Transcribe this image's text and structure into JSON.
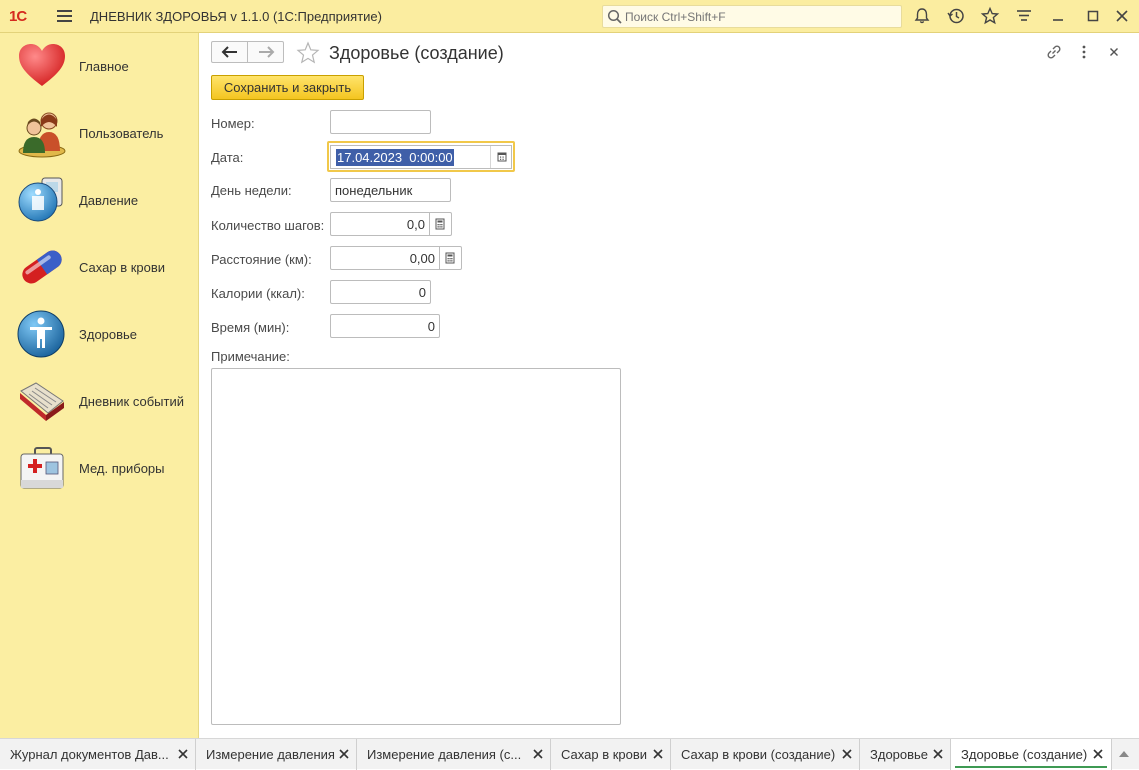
{
  "app": {
    "logo": "1С",
    "title": "ДНЕВНИК ЗДОРОВЬЯ v 1.1.0  (1С:Предприятие)",
    "search_placeholder": "Поиск Ctrl+Shift+F"
  },
  "toolbar_icons": [
    "bell-icon",
    "history-icon",
    "star-icon",
    "settings-icon",
    "minimize-icon",
    "maximize-icon",
    "close-icon"
  ],
  "sidebar": {
    "items": [
      {
        "label": "Главное",
        "icon": "heart-icon"
      },
      {
        "label": "Пользователь",
        "icon": "users-icon"
      },
      {
        "label": "Давление",
        "icon": "pressure-icon"
      },
      {
        "label": "Сахар в крови",
        "icon": "pill-icon"
      },
      {
        "label": "Здоровье",
        "icon": "person-icon"
      },
      {
        "label": "Дневник событий",
        "icon": "diary-icon"
      },
      {
        "label": "Мед. приборы",
        "icon": "medkit-icon"
      }
    ]
  },
  "form": {
    "title": "Здоровье (создание)",
    "save_label": "Сохранить и закрыть",
    "fields": {
      "number": {
        "label": "Номер:",
        "value": ""
      },
      "date": {
        "label": "Дата:",
        "value": "17.04.2023  0:00:00"
      },
      "weekday": {
        "label": "День недели:",
        "value": "понедельник"
      },
      "steps": {
        "label": "Количество шагов:",
        "value": "0,0"
      },
      "distance": {
        "label": "Расстояние (км):",
        "value": "0,00"
      },
      "calories": {
        "label": "Калории (ккал):",
        "value": "0"
      },
      "time": {
        "label": "Время (мин):",
        "value": "0"
      },
      "note": {
        "label": "Примечание:",
        "value": ""
      }
    }
  },
  "tabs": [
    {
      "label": "Журнал документов Дав...",
      "active": false
    },
    {
      "label": "Измерение давления",
      "active": false
    },
    {
      "label": "Измерение давления (с...",
      "active": false
    },
    {
      "label": "Сахар в крови",
      "active": false
    },
    {
      "label": "Сахар в крови (создание)",
      "active": false
    },
    {
      "label": "Здоровье",
      "active": false
    },
    {
      "label": "Здоровье (создание)",
      "active": true
    }
  ],
  "colors": {
    "title_bar": "#fbeda0",
    "sidebar": "#fbeea2",
    "save_button": "#f4c520",
    "date_focus": "#f1c84a",
    "selection": "#3f5fa8",
    "active_tab_underline": "#3e9a53"
  }
}
